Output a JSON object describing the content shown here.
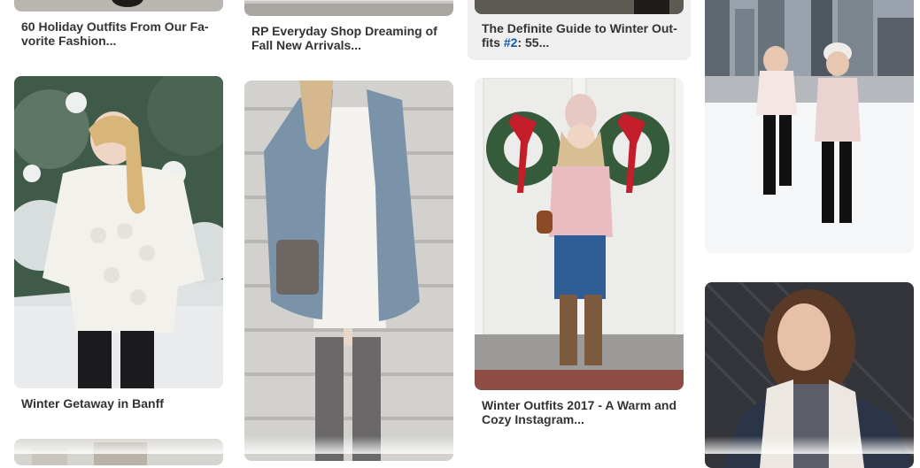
{
  "pins": [
    {
      "id": "holiday-outfits",
      "caption": "60 Holiday Outfits From Our Fa-\nvorite Fashion..."
    },
    {
      "id": "everyday-shop",
      "caption": "RP Everyday Shop Dreaming of\nFall New Arrivals..."
    },
    {
      "id": "winter-guide",
      "caption_pre": "The Definite Guide to Winter Out-\nfits ",
      "caption_hash": "#2",
      "caption_post": ": 55..."
    },
    {
      "id": "winter-getaway",
      "caption": "Winter Getaway in Banff"
    },
    {
      "id": "winter-outfits-2017",
      "caption": "Winter Outfits 2017 - A Warm and\nCozy Instagram..."
    }
  ],
  "colors": {
    "accent": "#0e5bb4",
    "card_hover": "#efefef",
    "text": "#333333"
  }
}
